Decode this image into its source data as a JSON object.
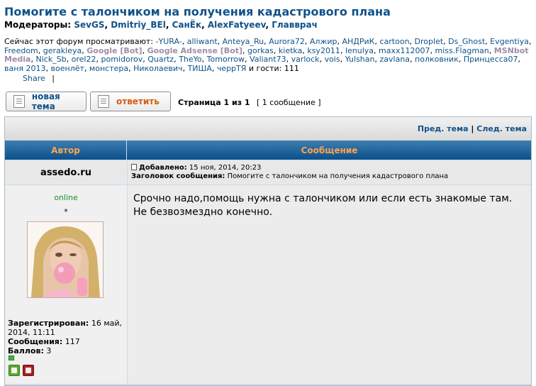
{
  "topic": {
    "title": "Помогите с талончиком на получения кадастрового плана"
  },
  "moderators": {
    "label": "Модераторы:",
    "names": [
      "SevGS",
      "Dmitriy_BEl",
      "СанЁк",
      "AlexFatyeev",
      "Главврач"
    ]
  },
  "viewers": {
    "label": "Сейчас этот форум просматривают:",
    "users": [
      "-YURA-",
      "alliwant",
      "Anteya_Ru",
      "Aurora72",
      "Алжир",
      "АНДРиК",
      "cartoon",
      "Droplet",
      "Ds_Ghost",
      "Evgentiya",
      "Freedom",
      "gerakleya",
      "Google [Bot]",
      "Google Adsense [Bot]",
      "gorkas",
      "kietka",
      "ksy2011",
      "lenulya",
      "maxx112007",
      "miss.Flagman",
      "MSNbot Media",
      "Nick_Sb",
      "orel22",
      "pomidorov",
      "Quartz",
      "TheYo",
      "Tomorrow",
      "Valiant73",
      "varlock",
      "vois",
      "Yulshan",
      "zavlana",
      "полковник",
      "Принцесса07",
      "ваня 2013",
      "военлёт",
      "монстера",
      "Николаевич",
      "ТИША",
      "черрТЯ"
    ],
    "bots": [
      "Google [Bot]",
      "Google Adsense [Bot]",
      "MSNbot Media"
    ],
    "guests_label": "и гости:",
    "guests_count": "111"
  },
  "share": {
    "label": "Share",
    "sep": "|"
  },
  "buttons": {
    "new_topic": "новая тема",
    "reply": "ответить"
  },
  "pagination": {
    "page_label": "Страница 1 из 1",
    "count_label": "[ 1 сообщение ]"
  },
  "nav": {
    "prev": "Пред. тема",
    "sep": "|",
    "next": "След. тема"
  },
  "table": {
    "col_author": "Автор",
    "col_message": "Сообщение"
  },
  "post": {
    "author": "assedo.ru",
    "added_label": "Добавлено:",
    "added_date": "15 ноя, 2014, 20:23",
    "subject_label": "Заголовок сообщения:",
    "subject": "Помогите с талончиком на получения кадастрового плана",
    "body": "Срочно надо,помощь нужна с талончиком или если есть знакомые там. Не безвозмездно конечно."
  },
  "profile": {
    "status": "online",
    "rank": "*",
    "registered_label": "Зарегистрирован:",
    "registered": "16 май, 2014, 11:11",
    "posts_label": "Сообщения:",
    "posts": "117",
    "points_label": "Баллов:",
    "points": "3"
  },
  "colors": {
    "link": "#105289",
    "header_text": "#ffa34f",
    "header_bg": "#0b4f8a",
    "online": "#1e8a32",
    "bot": "#9E8DA7"
  }
}
